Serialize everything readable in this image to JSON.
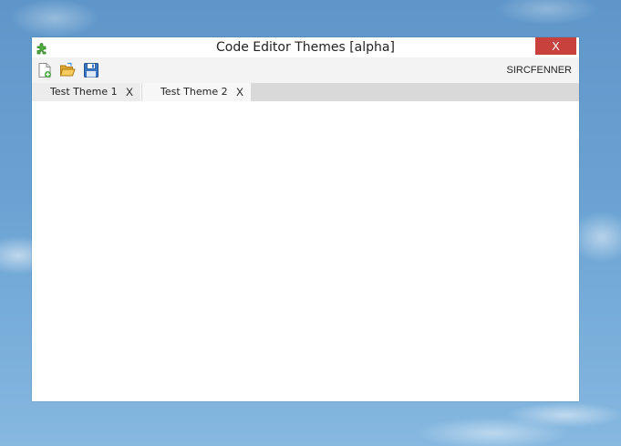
{
  "window": {
    "title": "Code Editor Themes [alpha]",
    "close_label": "X"
  },
  "toolbar": {
    "icons": [
      "new-file-icon",
      "open-folder-icon",
      "save-icon"
    ],
    "username": "SIRCFENNER"
  },
  "tabs": [
    {
      "label": "Test Theme 1",
      "close_label": "X"
    },
    {
      "label": "Test Theme 2",
      "close_label": "X",
      "active": true
    }
  ],
  "colors": {
    "close_button": "#c9413d",
    "toolbar_bg": "#f3f3f3",
    "tabstrip_bg": "#d9d9d9",
    "desktop_sky": "#6aa3d3"
  }
}
